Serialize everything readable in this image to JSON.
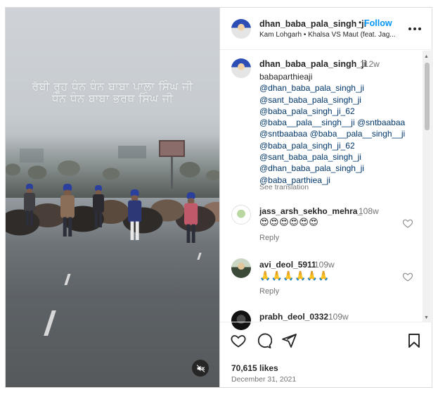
{
  "media": {
    "overlay_line1": "ਰੱਬੀ ਰੂਹ ਧੰਨ ਧੰਨ ਬਾਬਾ ਪਾਲਾ ਸਿੰਘ ਜੀ",
    "overlay_line2": "ਧੰਨ ਧੰਨ ਬਾਬਾ ਭਰਥ ਸਿੰਘ ਜੀ",
    "mute_icon": "speaker-muted-icon"
  },
  "header": {
    "username": "dhan_baba_pala_singh_ji",
    "separator": "•",
    "follow_label": "Follow",
    "audio": "Kam Lohgarh • Khalsa VS Maut (feat. Jag..."
  },
  "caption": {
    "username": "dhan_baba_pala_singh_ji",
    "time": "112w",
    "first_line": "babaparthieaji",
    "mention_lines": [
      "@dhan_baba_pala_singh_ji",
      "@sant_baba_pala_singh_ji",
      "@baba_pala_singh_ji_62",
      "@baba__pala__singh__ji @sntbaabaa",
      "@sntbaabaa @baba__pala__singh__ji",
      "@baba_pala_singh_ji_62",
      "@sant_baba_pala_singh_ji",
      "@dhan_baba_pala_singh_ji",
      "@baba_parthiea_ji"
    ],
    "see_translation": "See translation"
  },
  "comments": [
    {
      "username": "jass_arsh_sekho_mehra_",
      "time": "108w",
      "text": "😍😍😍😍😍😍",
      "reply": "Reply"
    },
    {
      "username": "avi_deol_5911",
      "time": "109w",
      "text": "🙏🙏🙏🙏🙏🙏",
      "reply": "Reply"
    },
    {
      "username": "prabh_deol_0332",
      "time": "109w"
    }
  ],
  "actions": {
    "likes": "70,615 likes",
    "date": "December 31, 2021",
    "icons": [
      "heart-icon",
      "comment-icon",
      "share-icon",
      "bookmark-icon"
    ]
  },
  "colors": {
    "link": "#00376b",
    "follow": "#0095f6",
    "muted_text": "#737373",
    "turban_blue": "#2b3f9c"
  }
}
